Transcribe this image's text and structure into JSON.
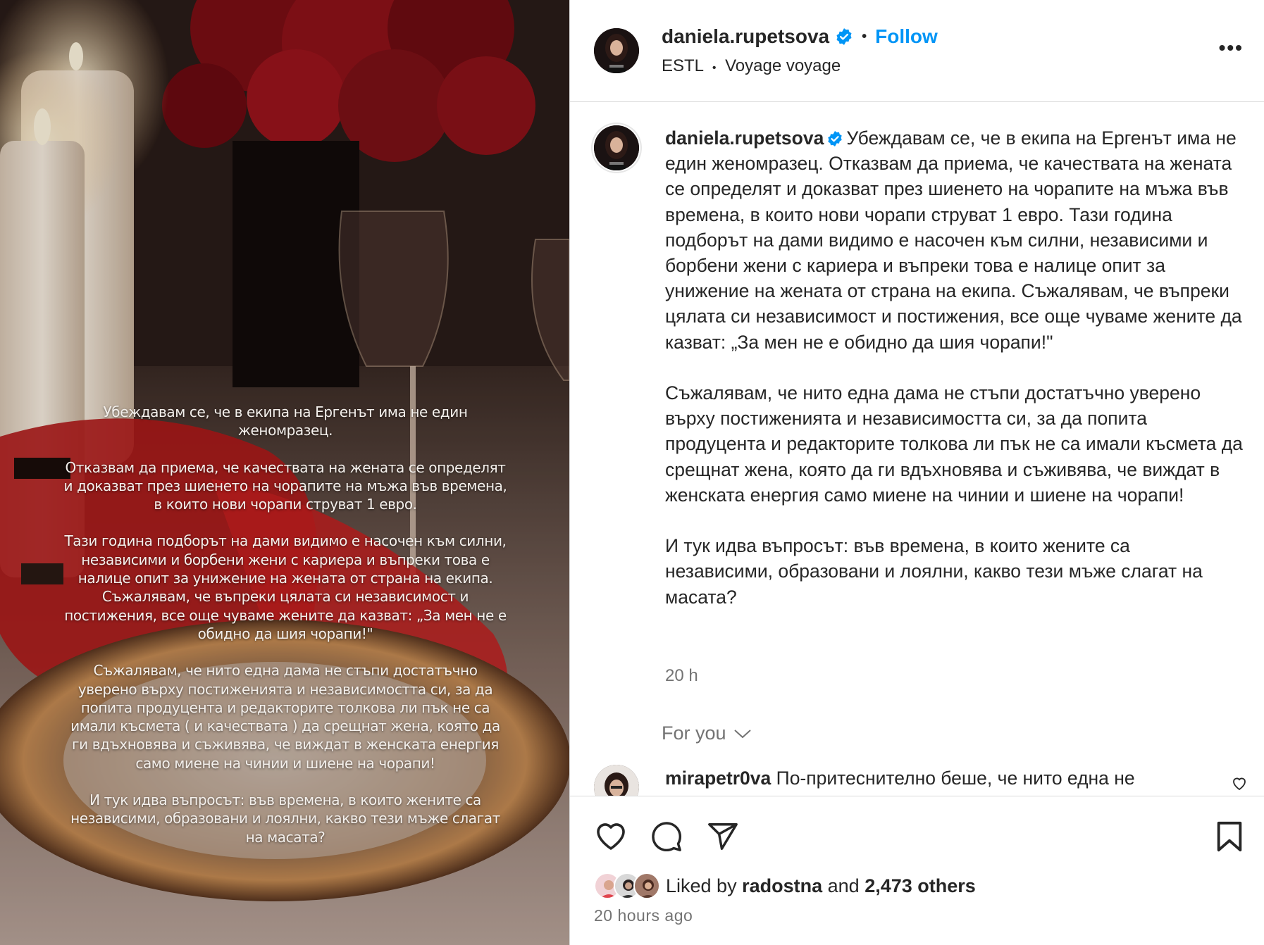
{
  "post": {
    "username": "daniela.rupetsova",
    "follow_label": "Follow",
    "dot": "•",
    "subtitle_left": "ESTL",
    "subtitle_sep": "•",
    "subtitle_right": "Voyage voyage",
    "more_label": "•••"
  },
  "media": {
    "overlay_paragraphs": [
      "Убеждавам се, че в екипа на Ергенът има не един женомразец.",
      "Отказвам да приема, че качествата на жената се определят и доказват през шиенето на чорапите на мъжа във времена, в които нови чорапи струват 1 евро.",
      "Тази година подборът на дами видимо е насочен към силни, независими и борбени жени с кариера и въпреки това е налице опит за унижение на жената от страна на екипа. Съжалявам, че въпреки цялата си независимост и постижения, все още чуваме жените да казват: „За мен не е обидно да шия чорапи!\"",
      "Съжалявам, че нито една дама не стъпи достатъчно уверено върху постиженията и независимостта си, за да попита продуцента и редакторите толкова ли пък не са имали късмета ( и качествата ) да срещнат жена, която да ги вдъхновява и съживява, че виждат в женската енергия само миене на чинии и шиене на чорапи!",
      "И тук идва въпросът: във времена, в които жените са независими, образовани и лоялни, какво тези мъже слагат на масата?"
    ]
  },
  "caption": {
    "username": "daniela.rupetsova",
    "p1": "Убеждавам се, че в екипа на Ергенът има не един женомразец. Отказвам да приема, че качествата на жената се определят и доказват през шиенето на чорапите на мъжа във времена, в които нови чорапи струват 1 евро. Тази година подборът на дами видимо е насочен към силни, независими и борбени жени с кариера и въпреки това е налице опит за унижение на жената от страна на екипа. Съжалявам, че въпреки цялата си независимост и постижения, все още чуваме жените да казват: „За мен не е обидно да шия чорапи!\"",
    "p2": "Съжалявам, че нито една дама не стъпи достатъчно уверено върху постиженията и независимостта си, за да попита продуцента и редакторите толкова ли пък не са имали късмета да срещнат жена, която да ги вдъхновява и съживява, че виждат в женската енергия само миене на чинии и шиене на чорапи!",
    "p3": "И тук идва въпросът: във времена, в които жените са независими, образовани и лоялни, какво тези мъже слагат на масата?",
    "time": "20 h"
  },
  "for_you_label": "For you",
  "comment": {
    "username": "mirapetr0va",
    "text": "По-притеснително беше, че нито една не"
  },
  "likes": {
    "prefix": "Liked by",
    "user": "radostna",
    "and": "and",
    "others": "2,473 others"
  },
  "posted_ago": "20 hours ago",
  "colors": {
    "accent": "#0095f6",
    "text": "#262626",
    "secondary": "#737373",
    "border": "#dbdbdb"
  }
}
